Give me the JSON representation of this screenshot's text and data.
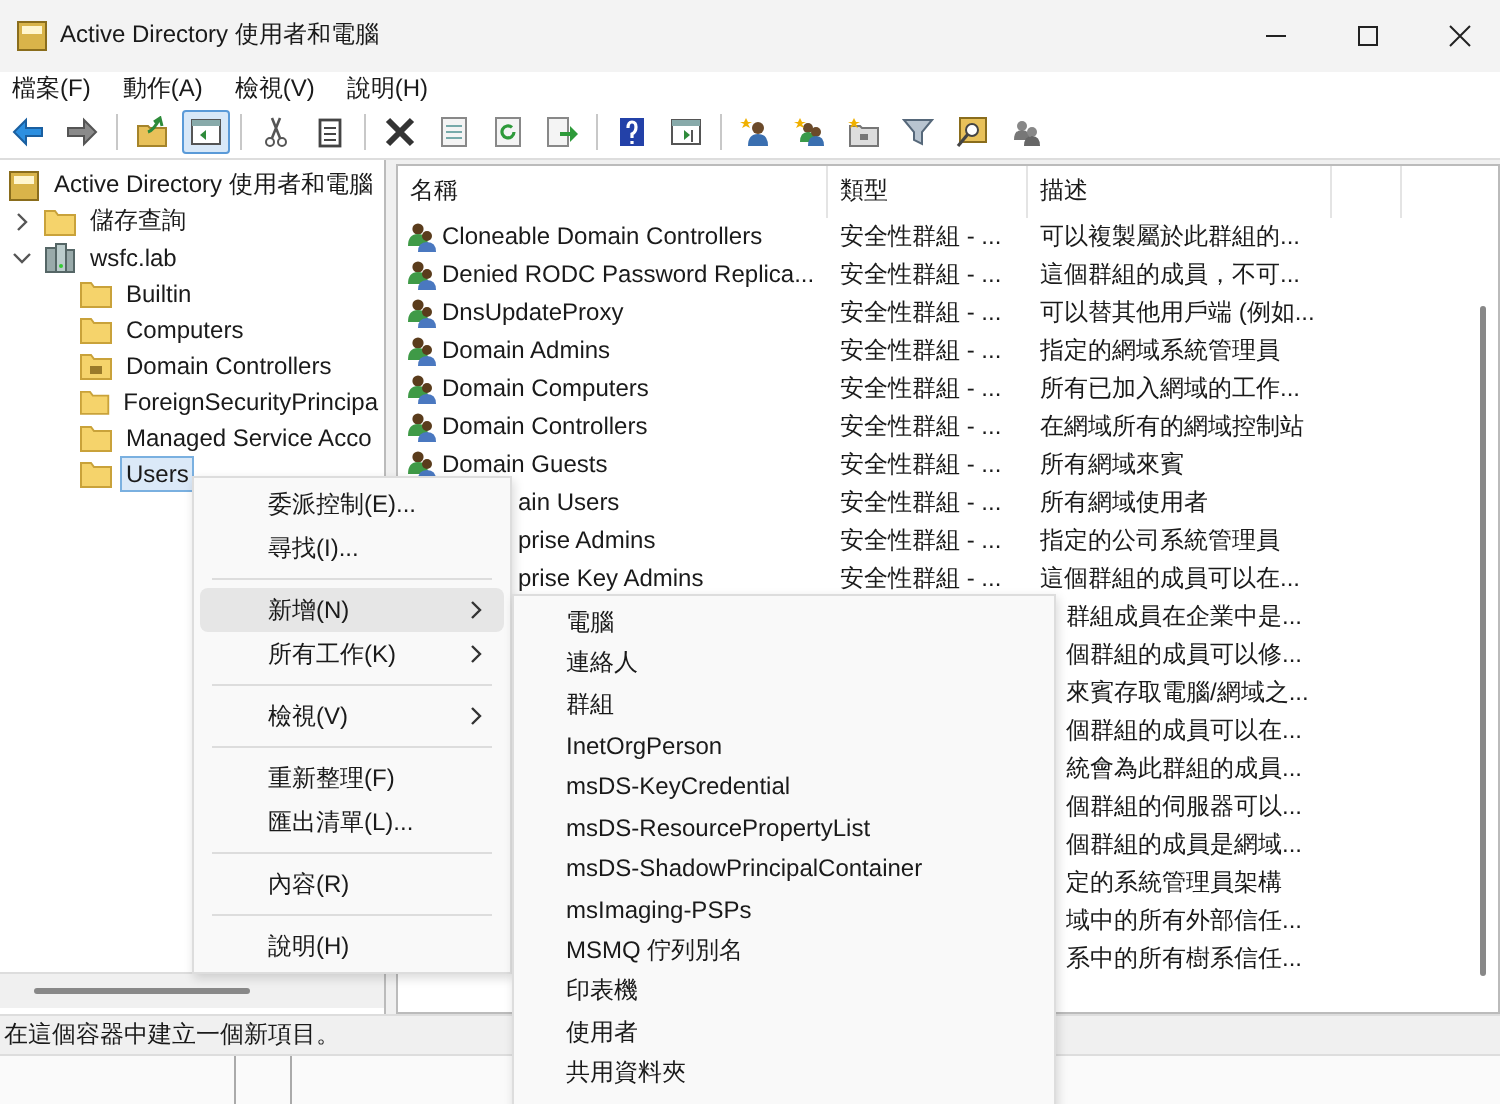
{
  "window": {
    "title": "Active Directory 使用者和電腦"
  },
  "menu_bar": [
    "檔案(F)",
    "動作(A)",
    "檢視(V)",
    "說明(H)"
  ],
  "toolbar": [
    [
      {
        "kind": "back",
        "pressed": false
      },
      {
        "kind": "forward",
        "pressed": false
      }
    ],
    [
      {
        "kind": "up",
        "pressed": false
      },
      {
        "kind": "console_tree",
        "pressed": true
      }
    ],
    [
      {
        "kind": "cut",
        "pressed": false
      },
      {
        "kind": "paste",
        "pressed": false
      }
    ],
    [
      {
        "kind": "delete",
        "pressed": false
      },
      {
        "kind": "properties",
        "pressed": false
      },
      {
        "kind": "refresh",
        "pressed": false
      },
      {
        "kind": "export",
        "pressed": false
      }
    ],
    [
      {
        "kind": "help",
        "pressed": false
      },
      {
        "kind": "action_pane",
        "pressed": false
      }
    ],
    [
      {
        "kind": "new_user",
        "pressed": false
      },
      {
        "kind": "new_group",
        "pressed": false
      },
      {
        "kind": "new_ou",
        "pressed": false
      },
      {
        "kind": "filter",
        "pressed": false
      },
      {
        "kind": "find",
        "pressed": false
      },
      {
        "kind": "add_to_group",
        "pressed": false
      }
    ]
  ],
  "tree": {
    "items": [
      {
        "label": "Active Directory 使用者和電腦",
        "kind": "console",
        "selected": false,
        "children": [
          {
            "label": "儲存查詢",
            "kind": "folder",
            "expanded": false,
            "selected": false
          },
          {
            "label": "wsfc.lab",
            "kind": "domain",
            "expanded": true,
            "selected": false,
            "children": [
              {
                "label": "Builtin",
                "kind": "folder",
                "selected": false
              },
              {
                "label": "Computers",
                "kind": "folder",
                "selected": false
              },
              {
                "label": "Domain Controllers",
                "kind": "ou",
                "selected": false
              },
              {
                "label": "ForeignSecurityPrincipa",
                "kind": "folder",
                "selected": false
              },
              {
                "label": "Managed Service Acco",
                "kind": "folder",
                "selected": false
              },
              {
                "label": "Users",
                "kind": "folder",
                "selected": true
              }
            ]
          }
        ]
      }
    ]
  },
  "list": {
    "columns": [
      "名稱",
      "類型",
      "描述"
    ],
    "rows": [
      {
        "kind": "full",
        "name": "Cloneable Domain Controllers",
        "type": "安全性群組 - ...",
        "description": "可以複製屬於此群組的..."
      },
      {
        "kind": "full",
        "name": "Denied RODC Password Replica...",
        "type": "安全性群組 - ...",
        "description": "這個群組的成員，不可..."
      },
      {
        "kind": "full",
        "name": "DnsUpdateProxy",
        "type": "安全性群組 - ...",
        "description": "可以替其他用戶端 (例如..."
      },
      {
        "kind": "full",
        "name": "Domain Admins",
        "type": "安全性群組 - ...",
        "description": "指定的網域系統管理員"
      },
      {
        "kind": "full",
        "name": "Domain Computers",
        "type": "安全性群組 - ...",
        "description": "所有已加入網域的工作..."
      },
      {
        "kind": "full",
        "name": "Domain Controllers",
        "type": "安全性群組 - ...",
        "description": "在網域所有的網域控制站"
      },
      {
        "kind": "full",
        "name": "Domain Guests",
        "type": "安全性群組 - ...",
        "description": "所有網域來賓"
      },
      {
        "kind": "cut_name",
        "name": "ain Users",
        "type": "安全性群組 - ...",
        "description": "所有網域使用者"
      },
      {
        "kind": "cut_name",
        "name": "prise Admins",
        "type": "安全性群組 - ...",
        "description": "指定的公司系統管理員"
      },
      {
        "kind": "cut_name",
        "name": "prise Key Admins",
        "type": "安全性群組 - ...",
        "description": "這個群組的成員可以在..."
      },
      {
        "kind": "desc_only",
        "description": "群組成員在企業中是..."
      },
      {
        "kind": "desc_only",
        "description": "個群組的成員可以修..."
      },
      {
        "kind": "desc_only",
        "description": "來賓存取電腦/網域之..."
      },
      {
        "kind": "desc_only",
        "description": "個群組的成員可以在..."
      },
      {
        "kind": "desc_only",
        "description": "統會為此群組的成員..."
      },
      {
        "kind": "desc_only",
        "description": "個群組的伺服器可以..."
      },
      {
        "kind": "desc_only",
        "description": "個群組的成員是網域..."
      },
      {
        "kind": "desc_only",
        "description": "定的系統管理員架構"
      },
      {
        "kind": "desc_only",
        "description": "域中的所有外部信任..."
      },
      {
        "kind": "desc_only",
        "description": "系中的所有樹系信任..."
      }
    ]
  },
  "context_menu": {
    "groups": [
      [
        {
          "label": "委派控制(E)...",
          "submenu": false,
          "selected": false
        },
        {
          "label": "尋找(I)...",
          "submenu": false,
          "selected": false
        }
      ],
      [
        {
          "label": "新增(N)",
          "submenu": true,
          "selected": true
        },
        {
          "label": "所有工作(K)",
          "submenu": true,
          "selected": false
        }
      ],
      [
        {
          "label": "檢視(V)",
          "submenu": true,
          "selected": false
        }
      ],
      [
        {
          "label": "重新整理(F)",
          "submenu": false,
          "selected": false
        },
        {
          "label": "匯出清單(L)...",
          "submenu": false,
          "selected": false
        }
      ],
      [
        {
          "label": "內容(R)",
          "submenu": false,
          "selected": false
        }
      ],
      [
        {
          "label": "說明(H)",
          "submenu": false,
          "selected": false
        }
      ]
    ]
  },
  "submenu": {
    "items": [
      "電腦",
      "連絡人",
      "群組",
      "InetOrgPerson",
      "msDS-KeyCredential",
      "msDS-ResourcePropertyList",
      "msDS-ShadowPrincipalContainer",
      "msImaging-PSPs",
      "MSMQ 佇列別名",
      "印表機",
      "使用者",
      "共用資料夾"
    ]
  },
  "status_bar": "在這個容器中建立一個新項目。"
}
